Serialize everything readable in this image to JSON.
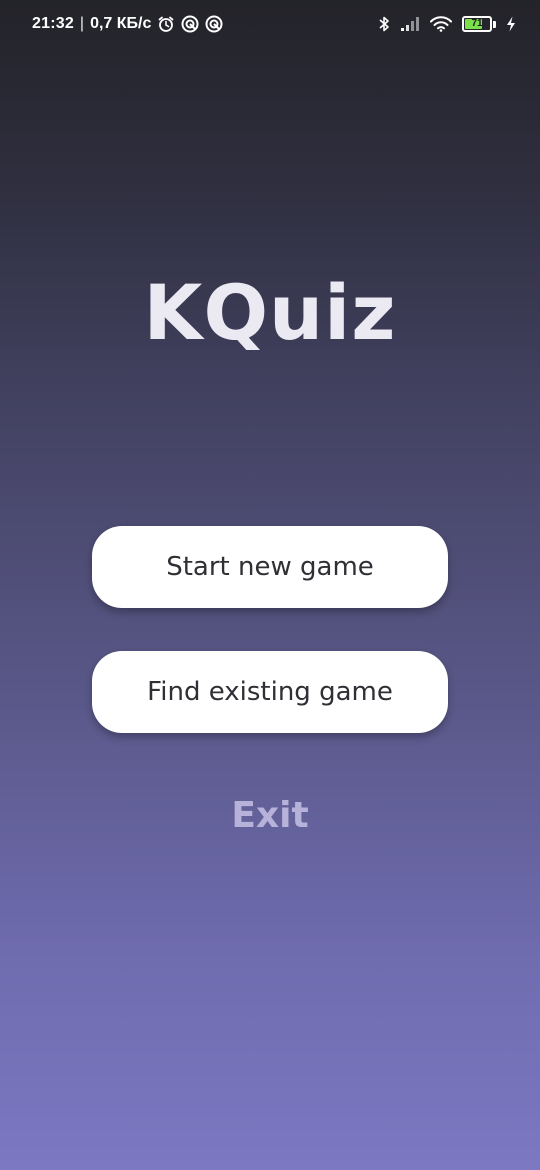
{
  "status_bar": {
    "time": "21:32",
    "separator": "|",
    "network_speed": "0,7 КБ/с",
    "left_icons": [
      "alarm-icon",
      "vpn-icon",
      "vpn-icon"
    ],
    "right_icons": [
      "bluetooth-icon",
      "signal-icon",
      "wifi-icon",
      "battery-icon",
      "charging-icon"
    ],
    "battery_level": "71",
    "battery_fraction": 0.71,
    "battery_color": "#7be04c"
  },
  "app": {
    "title": "KQuiz"
  },
  "menu": {
    "start_label": "Start new game",
    "find_label": "Find existing game",
    "exit_label": "Exit"
  },
  "colors": {
    "gradient_top": "#232329",
    "gradient_bottom": "#7c78c2",
    "title": "#ebe9f2",
    "button_bg": "#ffffff",
    "button_text": "#2f2f35",
    "exit_text": "#b7b2d9"
  }
}
